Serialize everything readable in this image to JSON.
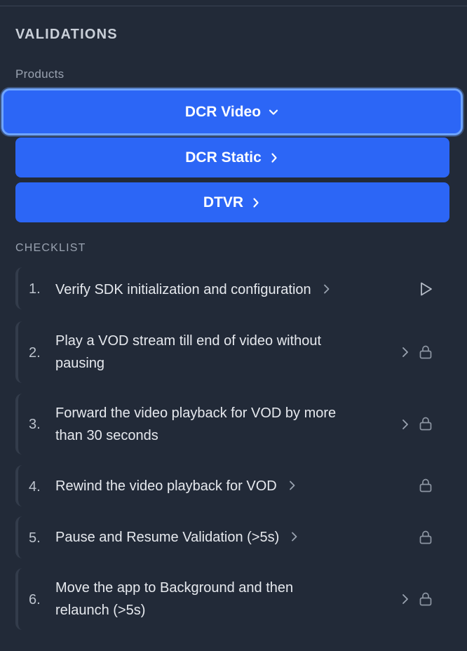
{
  "header": {
    "title": "VALIDATIONS"
  },
  "products": {
    "label": "Products",
    "items": [
      {
        "label": "DCR Video",
        "state": "expanded"
      },
      {
        "label": "DCR Static",
        "state": "collapsed"
      },
      {
        "label": "DTVR",
        "state": "collapsed"
      }
    ]
  },
  "checklist": {
    "label": "CHECKLIST",
    "items": [
      {
        "num": "1.",
        "line1": "Verify SDK initialization and configuration",
        "line2": "",
        "status": "play-icon"
      },
      {
        "num": "2.",
        "line1": "Play a VOD stream till end of video without",
        "line2": "pausing",
        "status": "lock-icon"
      },
      {
        "num": "3.",
        "line1": "Forward the video playback for VOD by more",
        "line2": "than 30 seconds",
        "status": "lock-icon"
      },
      {
        "num": "4.",
        "line1": "Rewind the video playback for VOD",
        "line2": "",
        "status": "lock-icon"
      },
      {
        "num": "5.",
        "line1": "Pause and Resume Validation (>5s)",
        "line2": "",
        "status": "lock-icon"
      },
      {
        "num": "6.",
        "line1": "Move the app to Background and then",
        "line2": "relaunch (>5s)",
        "status": "lock-icon"
      }
    ]
  },
  "colors": {
    "background": "#222a38",
    "accent": "#2c66f6",
    "focus_ring": "#6ea4ff"
  }
}
